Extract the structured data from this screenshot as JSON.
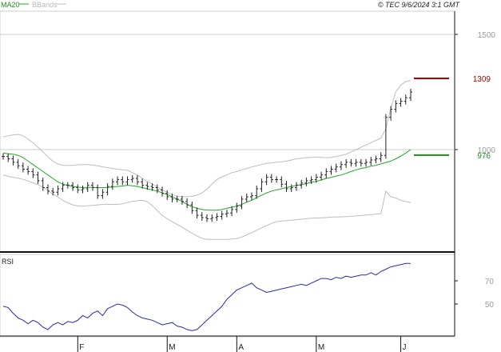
{
  "legend": {
    "ma_label": "MA20",
    "bb_label": "BBands"
  },
  "copyright": "© TEC 9/6/2024 3:1 GMT",
  "rsi_label": "RSI",
  "colors": {
    "ma": "#22a82a",
    "bb": "#bdbdbd",
    "bar": "#222222",
    "rsi": "#2a2ab0",
    "marker_red": "#b00000",
    "marker_green": "#1e8c1e",
    "axis": "#9a9a9a"
  },
  "chart_data": [
    {
      "type": "bar",
      "subtype": "ohlc-price",
      "y_ticks": [
        "1500",
        "1000"
      ],
      "gridlines": [
        1500,
        1000
      ],
      "ylim": [
        600,
        1650
      ],
      "x_ticks": [
        "F",
        "M",
        "A",
        "M",
        "J"
      ],
      "markers": [
        {
          "label": "1309",
          "value": 1309,
          "color": "#b00000"
        },
        {
          "label": "976",
          "value": 976,
          "color": "#1e8c1e"
        }
      ],
      "close": [
        970,
        960,
        945,
        930,
        915,
        905,
        890,
        865,
        835,
        820,
        815,
        830,
        845,
        845,
        835,
        825,
        830,
        845,
        835,
        800,
        815,
        840,
        860,
        870,
        860,
        870,
        875,
        860,
        845,
        840,
        835,
        825,
        810,
        795,
        785,
        785,
        775,
        760,
        735,
        715,
        705,
        700,
        705,
        710,
        720,
        725,
        740,
        755,
        785,
        795,
        800,
        830,
        860,
        880,
        870,
        870,
        850,
        830,
        835,
        845,
        855,
        865,
        870,
        880,
        890,
        905,
        915,
        925,
        935,
        945,
        940,
        945,
        940,
        945,
        955,
        960,
        975,
        1140,
        1175,
        1200,
        1210,
        1225,
        1250
      ],
      "ma20": [
        985,
        982,
        980,
        975,
        965,
        950,
        935,
        920,
        905,
        890,
        875,
        860,
        850,
        845,
        840,
        837,
        835,
        836,
        836,
        835,
        835,
        836,
        838,
        840,
        842,
        845,
        843,
        840,
        835,
        830,
        825,
        820,
        812,
        805,
        795,
        785,
        775,
        762,
        752,
        745,
        740,
        738,
        737,
        737,
        740,
        745,
        750,
        755,
        762,
        772,
        780,
        792,
        802,
        812,
        820,
        825,
        830,
        835,
        840,
        845,
        848,
        852,
        858,
        862,
        868,
        875,
        880,
        885,
        890,
        897,
        905,
        912,
        918,
        922,
        928,
        932,
        938,
        944,
        950,
        960,
        972,
        985,
        1000
      ],
      "bb_upper": [
        1055,
        1060,
        1064,
        1066,
        1060,
        1045,
        1030,
        1010,
        990,
        968,
        950,
        938,
        932,
        931,
        932,
        934,
        935,
        935,
        933,
        930,
        925,
        922,
        918,
        915,
        912,
        910,
        900,
        890,
        875,
        862,
        850,
        838,
        825,
        815,
        805,
        798,
        795,
        795,
        798,
        802,
        812,
        828,
        850,
        870,
        882,
        890,
        900,
        905,
        912,
        918,
        925,
        930,
        935,
        940,
        942,
        945,
        947,
        950,
        955,
        960,
        962,
        965,
        966,
        968,
        966,
        965,
        966,
        970,
        975,
        980,
        990,
        1000,
        1010,
        1020,
        1030,
        1040,
        1050,
        1090,
        1180,
        1250,
        1280,
        1295,
        1300
      ],
      "bb_lower": [
        890,
        884,
        880,
        876,
        871,
        864,
        856,
        848,
        837,
        822,
        807,
        795,
        780,
        768,
        760,
        756,
        755,
        756,
        758,
        760,
        762,
        763,
        762,
        762,
        765,
        770,
        775,
        778,
        780,
        774,
        757,
        735,
        715,
        700,
        687,
        675,
        663,
        650,
        637,
        625,
        615,
        610,
        610,
        610,
        610,
        610,
        612,
        614,
        620,
        630,
        640,
        650,
        660,
        670,
        680,
        687,
        690,
        692,
        694,
        696,
        698,
        700,
        702,
        703,
        704,
        705,
        707,
        708,
        708,
        709,
        710,
        712,
        714,
        716,
        718,
        720,
        722,
        820,
        795,
        790,
        780,
        775,
        770
      ]
    },
    {
      "type": "line",
      "subtype": "rsi",
      "y_ticks": [
        "70",
        "50"
      ],
      "ylim": [
        25,
        87
      ],
      "values": [
        48,
        47,
        42,
        38,
        36,
        33,
        36,
        34,
        30,
        28,
        32,
        34,
        32,
        35,
        34,
        36,
        40,
        38,
        42,
        44,
        40,
        46,
        48,
        50,
        49,
        47,
        43,
        40,
        38,
        37,
        36,
        34,
        32,
        33,
        34,
        31,
        30,
        28,
        27,
        28,
        32,
        36,
        40,
        44,
        48,
        54,
        58,
        62,
        64,
        66,
        68,
        64,
        62,
        60,
        61,
        62,
        63,
        64,
        65,
        66,
        67,
        66,
        68,
        70,
        72,
        72,
        71,
        73,
        72,
        74,
        73,
        74,
        75,
        75,
        77,
        75,
        78,
        80,
        82,
        83,
        84,
        85,
        85
      ],
      "x_ticks": [
        "F",
        "M",
        "A",
        "M",
        "J"
      ]
    }
  ]
}
